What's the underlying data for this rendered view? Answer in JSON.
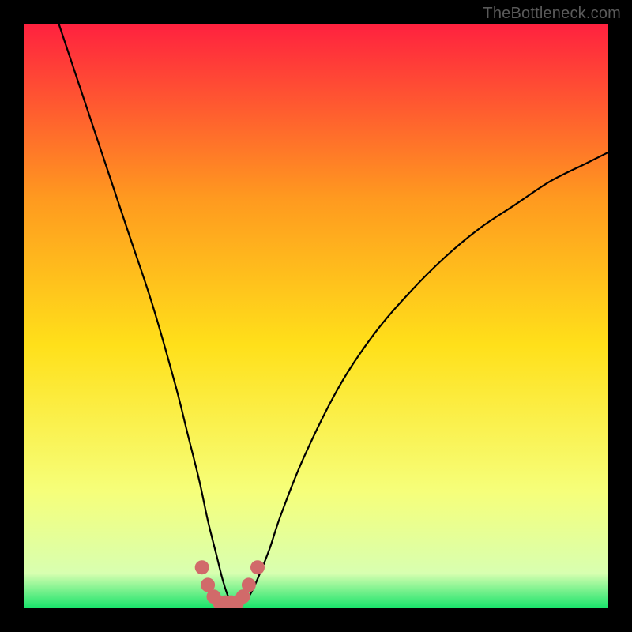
{
  "watermark": "TheBottleneck.com",
  "chart_data": {
    "type": "line",
    "title": "",
    "xlabel": "",
    "ylabel": "",
    "xlim": [
      0,
      100
    ],
    "ylim": [
      0,
      100
    ],
    "grid": false,
    "legend": false,
    "series": [
      {
        "name": "bottleneck-curve",
        "color": "#000000",
        "x": [
          6,
          10,
          14,
          18,
          22,
          26,
          28,
          30,
          31.5,
          33,
          34,
          35,
          36,
          37,
          38.5,
          40,
          42,
          44,
          48,
          54,
          60,
          66,
          72,
          78,
          84,
          90,
          96,
          100
        ],
        "y": [
          100,
          88,
          76,
          64,
          52,
          38,
          30,
          22,
          15,
          9,
          5,
          2,
          1,
          1,
          2,
          5,
          10,
          16,
          26,
          38,
          47,
          54,
          60,
          65,
          69,
          73,
          76,
          78
        ]
      },
      {
        "name": "optimal-zone-markers",
        "color": "#d16a6a",
        "marker": "circle",
        "x": [
          30.5,
          31.5,
          32.5,
          33.5,
          34.5,
          35.5,
          36.5,
          37.5,
          38.5,
          40.0
        ],
        "y": [
          7.0,
          4.0,
          2.0,
          1.0,
          1.0,
          1.0,
          1.0,
          2.0,
          4.0,
          7.0
        ]
      }
    ],
    "background_gradient": {
      "top": "#ff213f",
      "upper_mid": "#ff9a1f",
      "mid": "#ffe01a",
      "lower_mid": "#f6ff7a",
      "near_bottom": "#d8ffb0",
      "bottom": "#17e36a"
    }
  }
}
